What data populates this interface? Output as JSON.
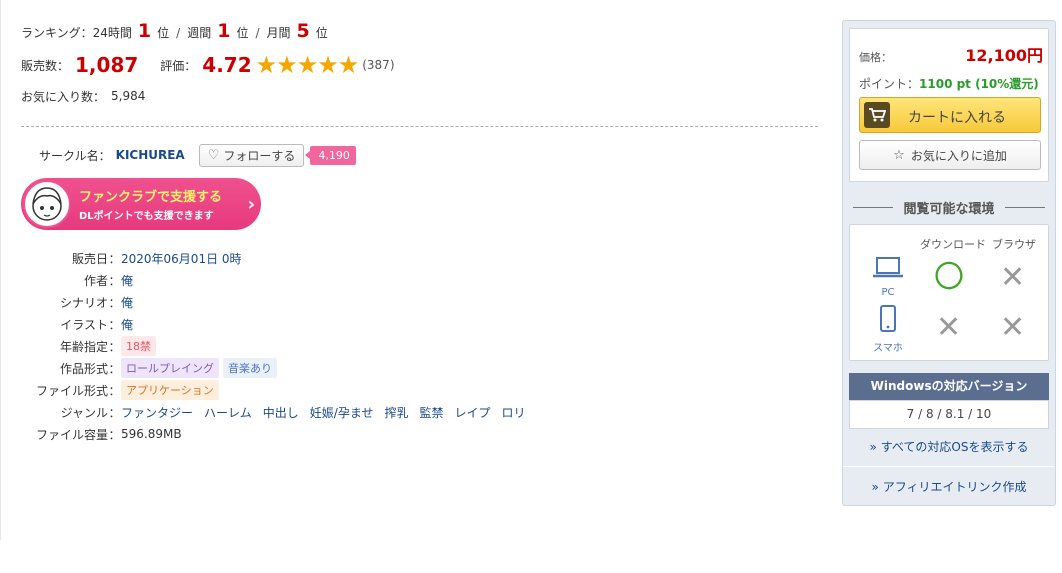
{
  "ranking": {
    "label": "ランキング：",
    "h24_label": "24時間",
    "h24_value": "1",
    "week_label": "週間",
    "week_value": "1",
    "month_label": "月間",
    "month_value": "5",
    "unit": "位",
    "sep": "/"
  },
  "sales": {
    "label": "販売数：",
    "value": "1,087",
    "rating_label": "評価：",
    "rating_value": "4.72",
    "stars": "★★★★★",
    "rating_count": "(387)"
  },
  "favorites": {
    "label": "お気に入り数：",
    "value": "5,984"
  },
  "circle": {
    "label": "サークル名：",
    "name": "KICHUREA",
    "follow_label": "フォローする",
    "follow_count": "4,190"
  },
  "fanclub": {
    "title": "ファンクラブで支援する",
    "subtitle": "DLポイントでも支援できます"
  },
  "specs": {
    "colon": "：",
    "release_label": "販売日",
    "release_value": "2020年06月01日 0時",
    "author_label": "作者",
    "author_value": "俺",
    "scenario_label": "シナリオ",
    "scenario_value": "俺",
    "illust_label": "イラスト",
    "illust_value": "俺",
    "age_label": "年齢指定",
    "age_value": "18禁",
    "format_label": "作品形式",
    "format_tags": [
      "ロールプレイング",
      "音楽あり"
    ],
    "filetype_label": "ファイル形式",
    "filetype_value": "アプリケーション",
    "genre_label": "ジャンル",
    "genres": [
      "ファンタジー",
      "ハーレム",
      "中出し",
      "妊娠/孕ませ",
      "搾乳",
      "監禁",
      "レイプ",
      "ロリ"
    ],
    "size_label": "ファイル容量",
    "size_value": "596.89MB"
  },
  "buy": {
    "price_label": "価格：",
    "price_value": "12,100円",
    "point_label": "ポイント：",
    "point_value": "1100 pt (10%還元)",
    "cart_label": "カートに入れる",
    "fav_label": "お気に入りに追加"
  },
  "env": {
    "title": "閲覧可能な環境",
    "col_download": "ダウンロード",
    "col_browser": "ブラウザ",
    "pc_label": "PC",
    "sp_label": "スマホ",
    "ok_mark": "〇",
    "ng_mark": "✕"
  },
  "windows": {
    "title": "Windowsの対応バージョン",
    "versions": "7 / 8 / 8.1 / 10",
    "all_os_link": "» すべての対応OSを表示する",
    "affiliate_link": "» アフィリエイトリンク作成"
  },
  "colors": {
    "accent_red": "#cc0000",
    "link_blue": "#1a4a8a",
    "star_gold": "#f5a700",
    "fanclub_pink": "#e63a7e",
    "ok_green": "#40a62a"
  }
}
